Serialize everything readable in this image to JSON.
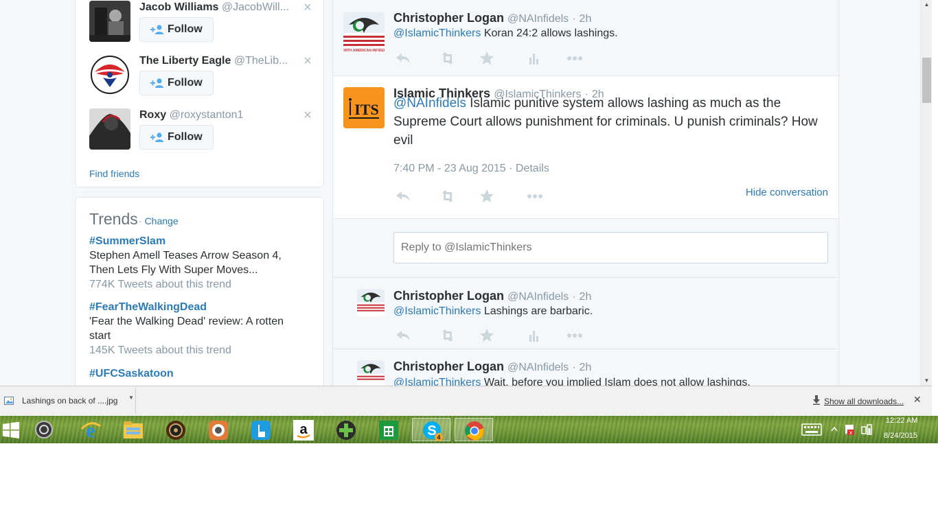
{
  "who_to_follow": [
    {
      "name": "Jacob Williams",
      "handle": "@JacobWill...",
      "follow_label": "Follow"
    },
    {
      "name": "The Liberty Eagle",
      "handle": "@TheLib...",
      "follow_label": "Follow"
    },
    {
      "name": "Roxy",
      "handle": "@roxystanton1",
      "follow_label": "Follow"
    }
  ],
  "find_friends": "Find friends",
  "trends": {
    "title": "Trends",
    "separator": "·",
    "change_label": "Change",
    "items": [
      {
        "tag": "#SummerSlam",
        "desc": "Stephen Amell Teases Arrow Season 4, Then Lets Fly With Super Moves...",
        "count": "774K Tweets about this trend"
      },
      {
        "tag": "#FearTheWalkingDead",
        "desc": "'Fear the Walking Dead' review: A rotten start",
        "count": "145K Tweets about this trend"
      },
      {
        "tag": "#UFCSaskatoon",
        "desc": "",
        "count": ""
      }
    ]
  },
  "tweets": {
    "t1": {
      "name": "Christopher Logan",
      "handle": "@NAInfidels",
      "sep": "·",
      "time": "2h",
      "mention": "@IslamicThinkers",
      "text": " Koran 24:2 allows lashings."
    },
    "t2": {
      "name": "Islamic Thinkers",
      "handle": "@IslamicThinkers",
      "sep": "·",
      "time": "2h",
      "mention": "@NAInfidels",
      "text": " Islamic punitive system allows lashing as much as the Supreme Court allows punishment for criminals. U punish criminals? How evil",
      "meta": "7:40 PM - 23 Aug 2015",
      "meta_sep": "·",
      "details": "Details",
      "hide_conversation": "Hide conversation",
      "avatar_text": "ITS"
    },
    "t3": {
      "name": "Christopher Logan",
      "handle": "@NAInfidels",
      "sep": "·",
      "time": "2h",
      "mention": "@IslamicThinkers",
      "text": " Lashings are barbaric."
    },
    "t4": {
      "name": "Christopher Logan",
      "handle": "@NAInfidels",
      "sep": "·",
      "time": "2h",
      "mention": "@IslamicThinkers",
      "text": " Wait, before you implied Islam does not allow lashings."
    }
  },
  "reply": {
    "placeholder": "Reply to @IslamicThinkers"
  },
  "download_bar": {
    "file_name": "Lashings on back of ....jpg",
    "show_all": "Show all downloads...",
    "close": "✕"
  },
  "taskbar": {
    "time": "12:22 AM",
    "date": "8/24/2015",
    "skype_badge": "4"
  },
  "colors": {
    "link": "#2b7bb9",
    "text": "#292f33",
    "muted": "#8899a6",
    "border": "#e1e8ed",
    "background": "#f5f8fa"
  }
}
